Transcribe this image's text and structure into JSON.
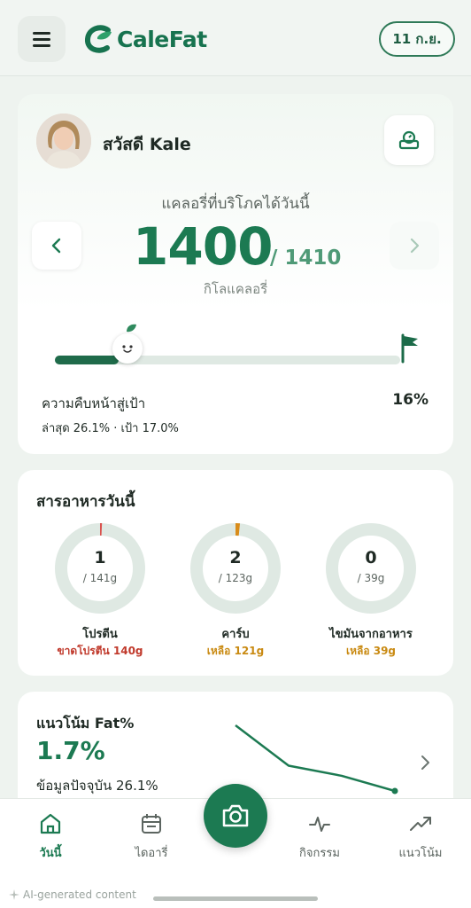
{
  "header": {
    "logo_text": "CaleFat",
    "date_chip": "11 ก.ย."
  },
  "calorie_card": {
    "greeting": "สวัสดี Kale",
    "label": "แคลอรี่ที่บริโภคได้วันนี้",
    "value": "1400",
    "goal": "/ 1410",
    "unit": "กิโลแคลอรี่",
    "progress_fraction": 0.16,
    "progress_label": "ความคืบหน้าสู่เป้า",
    "progress_percent": "16%",
    "progress_sub": "ล่าสุด 26.1% · เป้า 17.0%"
  },
  "nutrients": {
    "title": "สารอาหารวันนี้",
    "items": [
      {
        "value": "1",
        "goal": "/ 141g",
        "name": "โปรตีน",
        "note": "ขาดโปรตีน 140g",
        "note_color": "#c0392b",
        "accent": "#d9534f",
        "fraction": 0.007
      },
      {
        "value": "2",
        "goal": "/ 123g",
        "name": "คาร์บ",
        "note": "เหลือ 121g",
        "note_color": "#c98a12",
        "accent": "#d98c1a",
        "fraction": 0.016
      },
      {
        "value": "0",
        "goal": "/ 39g",
        "name": "ไขมันจากอาหาร",
        "note": "เหลือ 39g",
        "note_color": "#c98a12",
        "accent": "#c98a12",
        "fraction": 0
      }
    ]
  },
  "trend": {
    "title": "แนวโน้ม Fat%",
    "value": "1.7%",
    "current": "ข้อมูลปัจจุบัน 26.1%",
    "points": [
      30.0,
      27.6,
      27.0,
      26.1
    ]
  },
  "nav": {
    "items": [
      {
        "label": "วันนี้",
        "icon": "home-icon",
        "active": true
      },
      {
        "label": "ไดอารี่",
        "icon": "calendar-icon",
        "active": false
      },
      {
        "label": "กิจกรรม",
        "icon": "activity-icon",
        "active": false
      },
      {
        "label": "แนวโน้ม",
        "icon": "trend-icon",
        "active": false
      }
    ],
    "camera_icon": "camera-icon"
  },
  "footer": {
    "ai_note": "AI-generated content"
  },
  "colors": {
    "brand": "#1c7a52",
    "track": "#dfe9e3"
  }
}
